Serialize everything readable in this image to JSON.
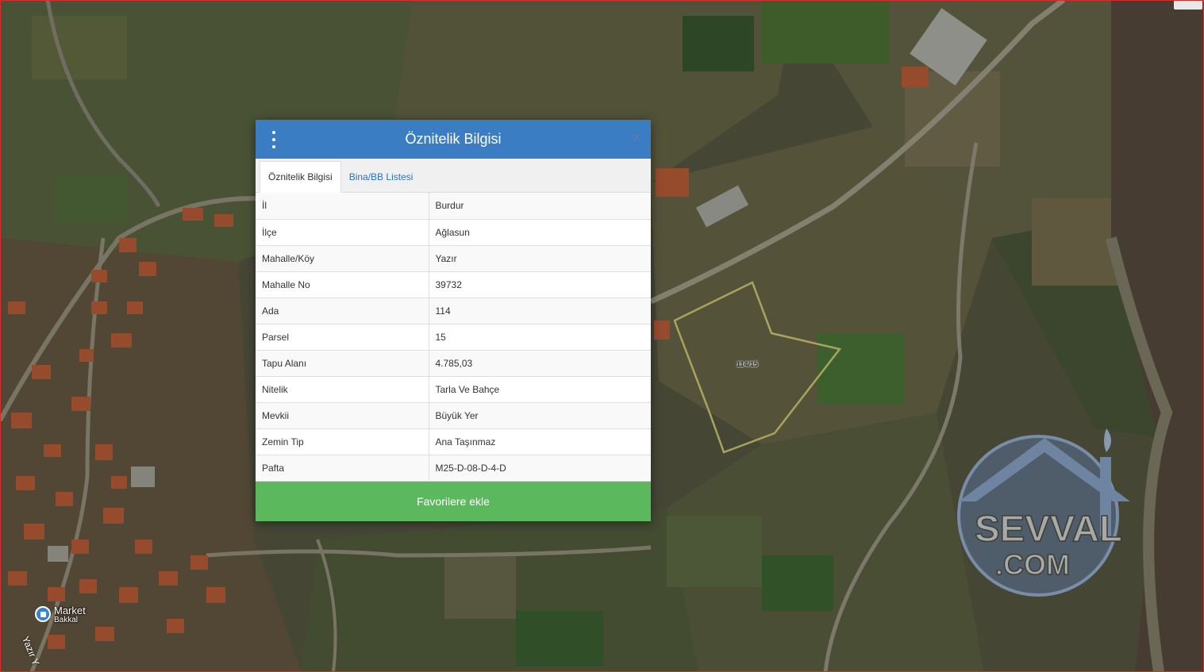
{
  "modal": {
    "title": "Öznitelik Bilgisi",
    "close_glyph": "×",
    "tabs": [
      {
        "label": "Öznitelik Bilgisi",
        "active": true
      },
      {
        "label": "Bina/BB Listesi",
        "active": false
      }
    ],
    "rows": [
      {
        "key": "İl",
        "value": "Burdur"
      },
      {
        "key": "İlçe",
        "value": "Ağlasun"
      },
      {
        "key": "Mahalle/Köy",
        "value": "Yazır"
      },
      {
        "key": "Mahalle No",
        "value": "39732"
      },
      {
        "key": "Ada",
        "value": "114"
      },
      {
        "key": "Parsel",
        "value": "15"
      },
      {
        "key": "Tapu Alanı",
        "value": "4.785,03"
      },
      {
        "key": "Nitelik",
        "value": "Tarla Ve Bahçe"
      },
      {
        "key": "Mevkii",
        "value": "Büyük Yer"
      },
      {
        "key": "Zemin Tip",
        "value": "Ana Taşınmaz"
      },
      {
        "key": "Pafta",
        "value": "M25-D-08-D-4-D"
      }
    ],
    "favorite_button": "Favorilere ekle"
  },
  "map": {
    "parcel_label": "114/15",
    "poi": {
      "name": "Market",
      "subtitle": "Bakkal",
      "icon": "shop-pin-icon"
    },
    "road_label": "Yazır Y"
  },
  "watermark": {
    "line1": "SEVVAL",
    "line2": ".COM"
  },
  "colors": {
    "header": "#3a7dc2",
    "favorite_button": "#5cb85c",
    "parcel_outline": "#d8d27a",
    "tab_link": "#2a72c4"
  }
}
